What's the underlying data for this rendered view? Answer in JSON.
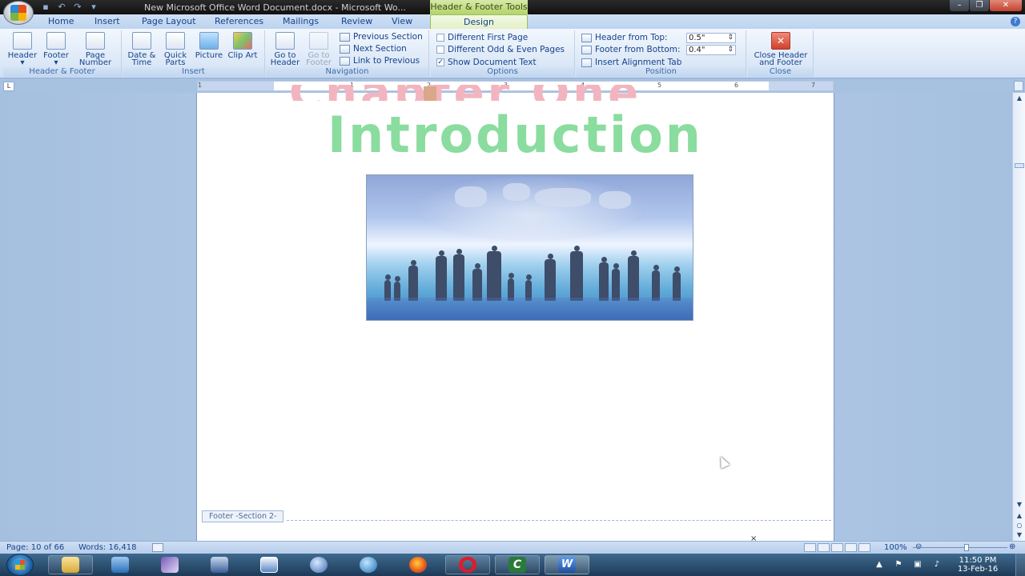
{
  "window": {
    "title": "New Microsoft Office Word Document.docx - Microsoft Wo...",
    "contextual_tools": "Header & Footer Tools"
  },
  "tabs": [
    {
      "label": "Home"
    },
    {
      "label": "Insert"
    },
    {
      "label": "Page Layout"
    },
    {
      "label": "References"
    },
    {
      "label": "Mailings"
    },
    {
      "label": "Review"
    },
    {
      "label": "View"
    },
    {
      "label": "Design"
    }
  ],
  "ribbon": {
    "header_footer": {
      "label": "Header & Footer",
      "header": "Header",
      "footer": "Footer",
      "page_number": "Page Number"
    },
    "insert": {
      "label": "Insert",
      "date_time": "Date & Time",
      "quick_parts": "Quick Parts",
      "picture": "Picture",
      "clip_art": "Clip Art"
    },
    "navigation": {
      "label": "Navigation",
      "go_to_header": "Go to Header",
      "go_to_footer": "Go to Footer",
      "previous_section": "Previous Section",
      "next_section": "Next Section",
      "link_to_previous": "Link to Previous"
    },
    "options": {
      "label": "Options",
      "different_first_page": "Different First Page",
      "different_odd_even": "Different Odd & Even Pages",
      "show_document_text": "Show Document Text",
      "show_document_text_checked": true
    },
    "position": {
      "label": "Position",
      "header_from_top": "Header from Top:",
      "header_from_top_value": "0.5\"",
      "footer_from_bottom": "Footer from Bottom:",
      "footer_from_bottom_value": "0.4\"",
      "insert_alignment_tab": "Insert Alignment Tab"
    },
    "close": {
      "label": "Close",
      "close_header_footer": "Close Header and Footer"
    }
  },
  "ruler": {
    "numbers": [
      "1",
      "1",
      "2",
      "3",
      "4",
      "5",
      "6",
      "7"
    ]
  },
  "document": {
    "ghost_heading": "Chapter One",
    "heading": "Introduction",
    "footer_tag": "Footer -Section 2-",
    "footer_close": "×"
  },
  "status": {
    "page": "Page: 10 of 66",
    "words": "Words: 16,418",
    "zoom": "100%"
  },
  "taskbar": {
    "time": "11:50 PM",
    "date": "13-Feb-16"
  },
  "colors": {
    "heading": "#8bdc9f",
    "ghost": "#f2b5bf",
    "ribbon_bg": "#dce8f7",
    "design_tab": "#b3d46a"
  }
}
